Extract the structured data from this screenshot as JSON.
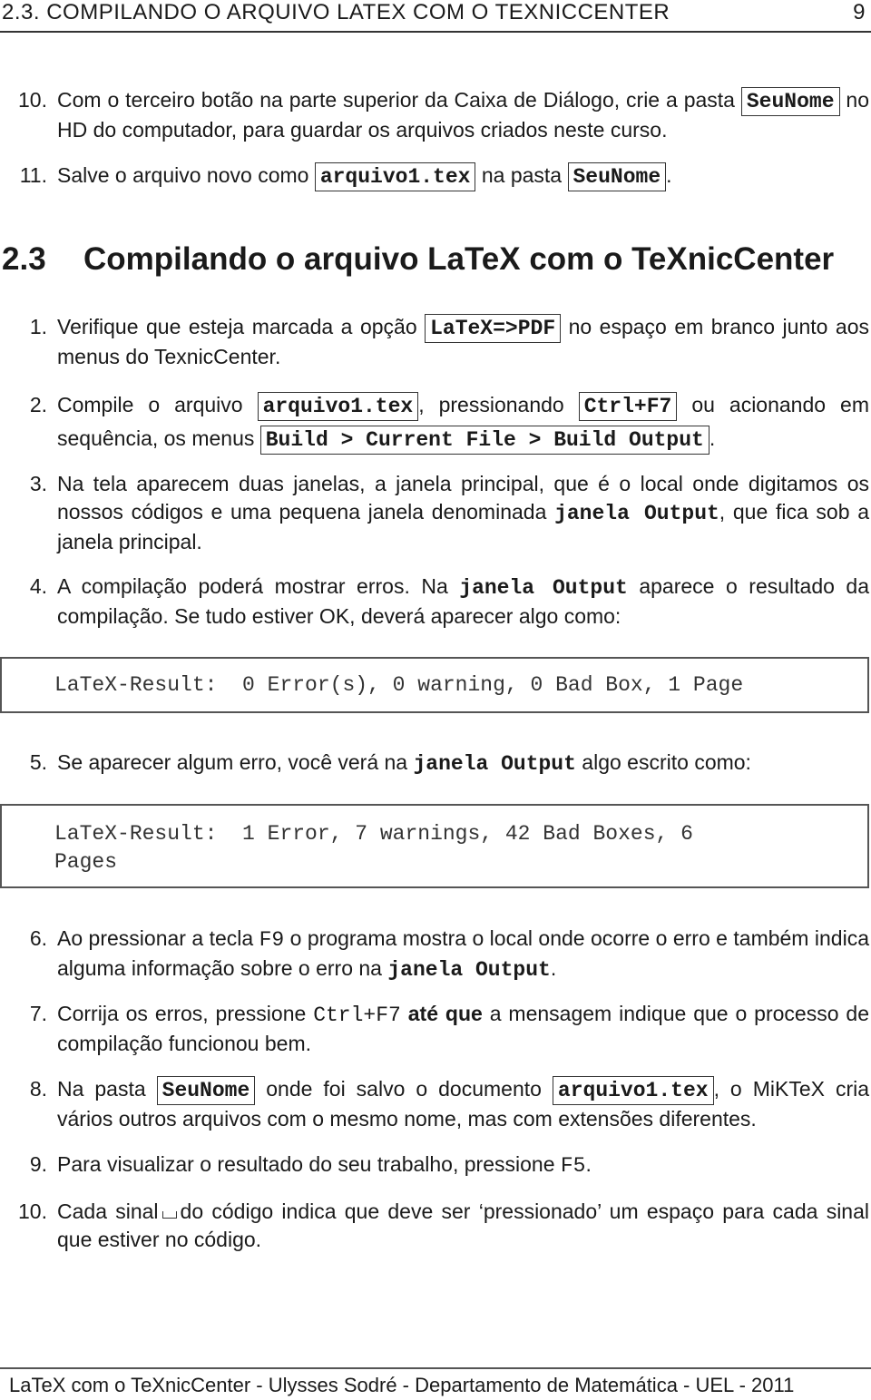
{
  "running_head": {
    "title": "2.3.  COMPILANDO O ARQUIVO LATEX COM O TEXNICCENTER",
    "page_number": "9"
  },
  "prev_list": [
    {
      "num": "10.",
      "parts": [
        "Com o terceiro botão na parte superior da Caixa de Diálogo, crie a pasta ",
        "SeuNome",
        " no HD do computador, para guardar os arquivos criados neste curso."
      ]
    },
    {
      "num": "11.",
      "parts": [
        "Salve o arquivo novo como ",
        "arquivo1.tex",
        " na pasta ",
        "SeuNome",
        "."
      ]
    }
  ],
  "section": {
    "number": "2.3",
    "title": "Compilando o arquivo LaTeX com o TeXnicCenter"
  },
  "steps": [
    {
      "num": "1.",
      "parts": [
        "Verifique que esteja marcada a opção ",
        "LaTeX=>PDF",
        " no espaço em branco junto aos menus do TexnicCenter."
      ]
    },
    {
      "num": "2.",
      "parts": [
        "Compile o arquivo ",
        "arquivo1.tex",
        ", pressionando ",
        "Ctrl+F7",
        " ou acionando em sequência, os menus ",
        "Build > Current File > Build Output",
        "."
      ]
    },
    {
      "num": "3.",
      "parts": [
        "Na tela aparecem duas janelas, a janela principal, que é o local onde digitamos os nossos códigos e uma pequena janela denominada ",
        "janela Output",
        ", que fica sob a janela principal."
      ]
    },
    {
      "num": "4.",
      "parts": [
        "A compilação poderá mostrar erros.  Na ",
        "janela Output",
        " aparece o resultado da compilação. Se tudo estiver OK, deverá aparecer algo como:"
      ]
    },
    {
      "num": "5.",
      "parts": [
        "Se aparecer algum erro, você verá na ",
        "janela Output",
        " algo escrito como:"
      ]
    },
    {
      "num": "6.",
      "parts": [
        "Ao pressionar a tecla ",
        "F9",
        " o programa mostra o local onde ocorre o erro e também indica alguma informação sobre o erro na ",
        "janela Output",
        "."
      ]
    },
    {
      "num": "7.",
      "parts": [
        "Corrija os erros, pressione ",
        "Ctrl+F7",
        " ",
        "até que",
        " a mensagem indique que o processo de compilação funcionou bem."
      ]
    },
    {
      "num": "8.",
      "parts": [
        "Na pasta ",
        "SeuNome",
        " onde foi salvo o documento ",
        "arquivo1.tex",
        ", o MiKTeX cria vários outros arquivos com o mesmo nome, mas com extensões diferentes."
      ]
    },
    {
      "num": "9.",
      "parts": [
        "Para visualizar o resultado do seu trabalho, pressione ",
        "F5",
        "."
      ]
    },
    {
      "num": "10.",
      "parts": [
        "Cada sinal",
        "do código indica que deve ser ‘pressionado’ um espaço para cada sinal que estiver no código."
      ]
    }
  ],
  "code_ok": "LaTeX-Result:  0 Error(s), 0 warning, 0 Bad Box, 1 Page",
  "code_err": "LaTeX-Result:  1 Error, 7 warnings, 42 Bad Boxes, 6\nPages",
  "footer": "LaTeX com o TeXnicCenter - Ulysses Sodré - Departamento de Matemática - UEL - 2011"
}
